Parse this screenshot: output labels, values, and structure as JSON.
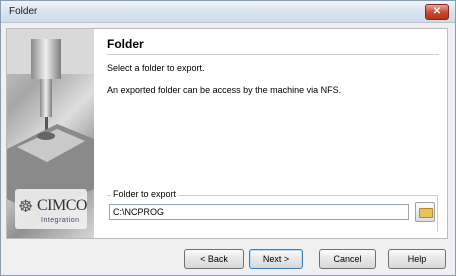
{
  "window": {
    "title": "Folder",
    "close_label": "✕"
  },
  "wizard": {
    "heading": "Folder",
    "line1": "Select a folder to export.",
    "line2": "An exported folder can be access by the machine via NFS."
  },
  "group": {
    "label": "Folder to export",
    "path_value": "C:\\NCPROG"
  },
  "logo": {
    "text": "CIMCO",
    "sub": "Integration"
  },
  "buttons": {
    "back": "< Back",
    "next": "Next >",
    "cancel": "Cancel",
    "help": "Help"
  }
}
